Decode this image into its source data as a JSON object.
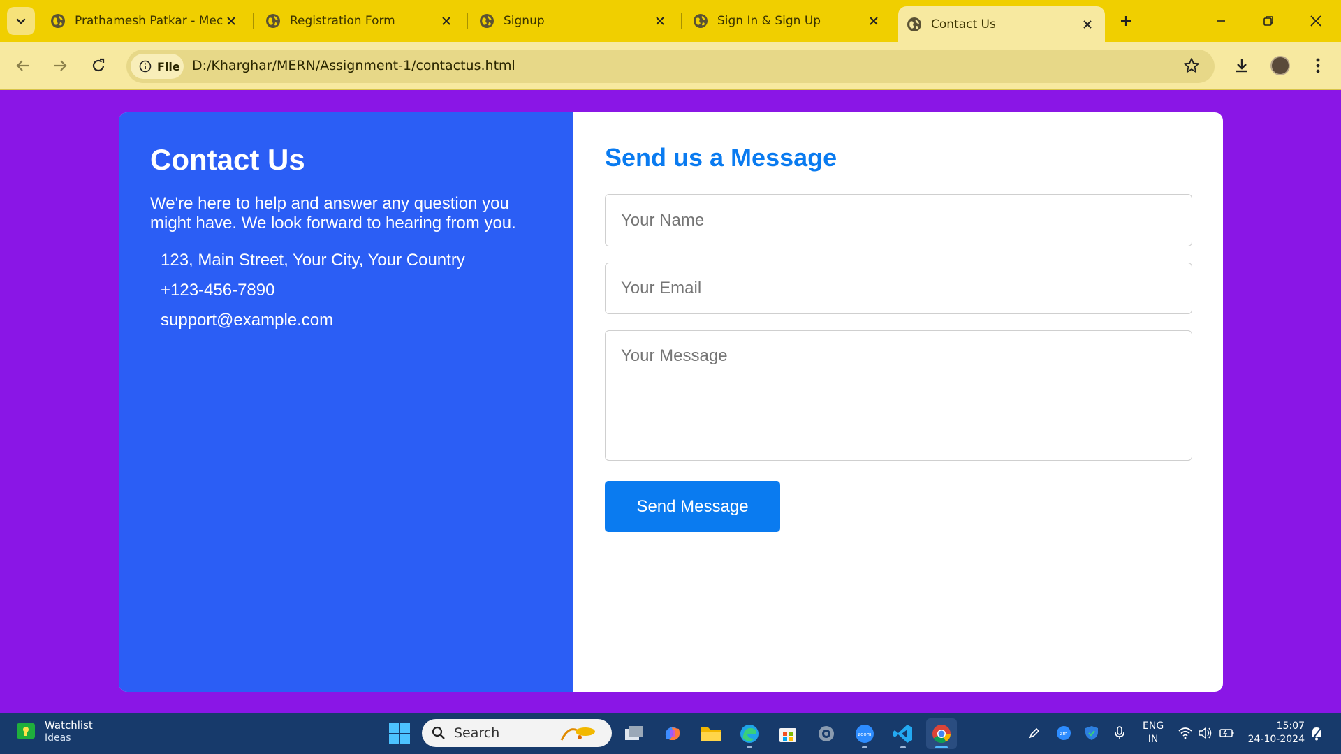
{
  "browser": {
    "tabs": [
      {
        "title": "Prathamesh Patkar - Mecha",
        "active": false
      },
      {
        "title": "Registration Form",
        "active": false
      },
      {
        "title": "Signup",
        "active": false
      },
      {
        "title": "Sign In & Sign Up",
        "active": false
      },
      {
        "title": "Contact Us",
        "active": true
      }
    ],
    "chip_label": "File",
    "url": "D:/Kharghar/MERN/Assignment-1/contactus.html"
  },
  "page": {
    "background": "#8a16e6",
    "info": {
      "title": "Contact Us",
      "description": "We're here to help and answer any question you might have. We look forward to hearing from you.",
      "address": "123, Main Street, Your City, Your Country",
      "phone": "+123-456-7890",
      "email": "support@example.com",
      "color": "#2b5ef5"
    },
    "form": {
      "title": "Send us a Message",
      "name_placeholder": "Your Name",
      "email_placeholder": "Your Email",
      "message_placeholder": "Your Message",
      "submit_label": "Send Message",
      "accent": "#0a7bf0"
    }
  },
  "taskbar": {
    "widget_title": "Watchlist",
    "widget_sub": "Ideas",
    "search_label": "Search",
    "apps": [
      "task-view-icon",
      "copilot-icon",
      "file-explorer-icon",
      "edge-icon",
      "store-icon",
      "settings-icon",
      "zoom-icon",
      "vscode-icon",
      "chrome-icon"
    ],
    "lang_line1": "ENG",
    "lang_line2": "IN",
    "time": "15:07",
    "date": "24-10-2024"
  }
}
